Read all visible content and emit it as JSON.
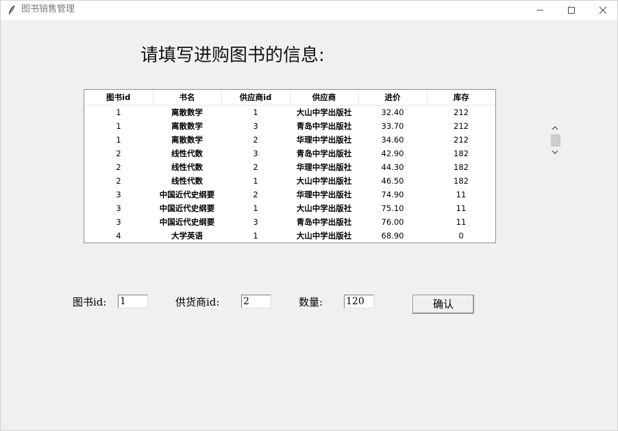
{
  "window": {
    "title": "图书销售管理"
  },
  "heading": "请填写进购图书的信息:",
  "table": {
    "headers": [
      "图书id",
      "书名",
      "供应商id",
      "供应商",
      "进价",
      "库存"
    ],
    "rows": [
      [
        "1",
        "离散数学",
        "1",
        "大山中学出版社",
        "32.40",
        "212"
      ],
      [
        "1",
        "离散数学",
        "3",
        "青岛中学出版社",
        "33.70",
        "212"
      ],
      [
        "1",
        "离散数学",
        "2",
        "华理中学出版社",
        "34.60",
        "212"
      ],
      [
        "2",
        "线性代数",
        "3",
        "青岛中学出版社",
        "42.90",
        "182"
      ],
      [
        "2",
        "线性代数",
        "2",
        "华理中学出版社",
        "44.30",
        "182"
      ],
      [
        "2",
        "线性代数",
        "1",
        "大山中学出版社",
        "46.50",
        "182"
      ],
      [
        "3",
        "中国近代史纲要",
        "2",
        "华理中学出版社",
        "74.90",
        "11"
      ],
      [
        "3",
        "中国近代史纲要",
        "1",
        "大山中学出版社",
        "75.10",
        "11"
      ],
      [
        "3",
        "中国近代史纲要",
        "3",
        "青岛中学出版社",
        "76.00",
        "11"
      ],
      [
        "4",
        "大学英语",
        "1",
        "大山中学出版社",
        "68.90",
        "0"
      ]
    ]
  },
  "form": {
    "book_id_label": "图书id:",
    "book_id_value": "1",
    "supplier_id_label": "供货商id:",
    "supplier_id_value": "2",
    "quantity_label": "数量:",
    "quantity_value": "120",
    "confirm_label": "确认"
  },
  "icons": {
    "app": "feather-icon",
    "minimize": "minimize-icon",
    "maximize": "maximize-icon",
    "close": "close-icon",
    "scroll_up": "chevron-up-icon",
    "scroll_down": "chevron-down-icon"
  }
}
